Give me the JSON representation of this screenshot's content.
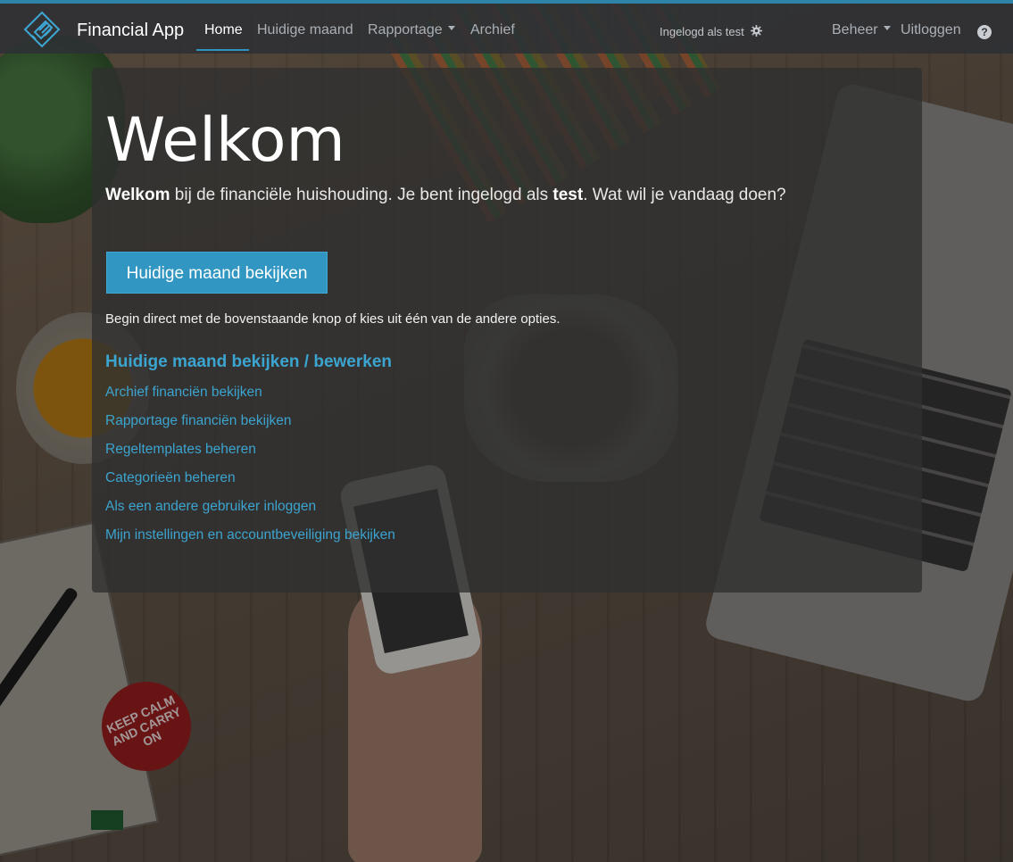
{
  "theme": {
    "accent": "#3197c2",
    "link": "#3ba4cf",
    "navbar_top_border": "#2d84a8"
  },
  "navbar": {
    "brand": "Financial App",
    "items": [
      {
        "label": "Home",
        "active": true
      },
      {
        "label": "Huidige maand"
      },
      {
        "label": "Rapportage",
        "dropdown": true
      },
      {
        "label": "Archief"
      }
    ],
    "logged_in_text": "Ingelogd als test",
    "settings_icon": "gear-icon",
    "right_items": [
      {
        "label": "Beheer",
        "dropdown": true
      },
      {
        "label": "Uitloggen"
      }
    ],
    "help_icon": "question-circle-icon",
    "help_glyph": "?"
  },
  "main": {
    "title": "Welkom",
    "lead": {
      "bold_1": "Welkom",
      "text_1": " bij de financiële huishouding. Je bent ingelogd als ",
      "bold_2": "test",
      "text_2": ". Wat wil je vandaag doen?"
    },
    "primary_button": "Huidige maand bekijken",
    "hint": "Begin direct met de bovenstaande knop of kies uit één van de andere opties.",
    "links": [
      "Huidige maand bekijken / bewerken",
      "Archief financiën bekijken",
      "Rapportage financiën bekijken",
      "Regeltemplates beheren",
      "Categorieën beheren",
      "Als een andere gebruiker inloggen",
      "Mijn instellingen en accountbeveiliging bekijken"
    ]
  },
  "background": {
    "badge_text": "KEEP CALM AND CARRY ON"
  }
}
